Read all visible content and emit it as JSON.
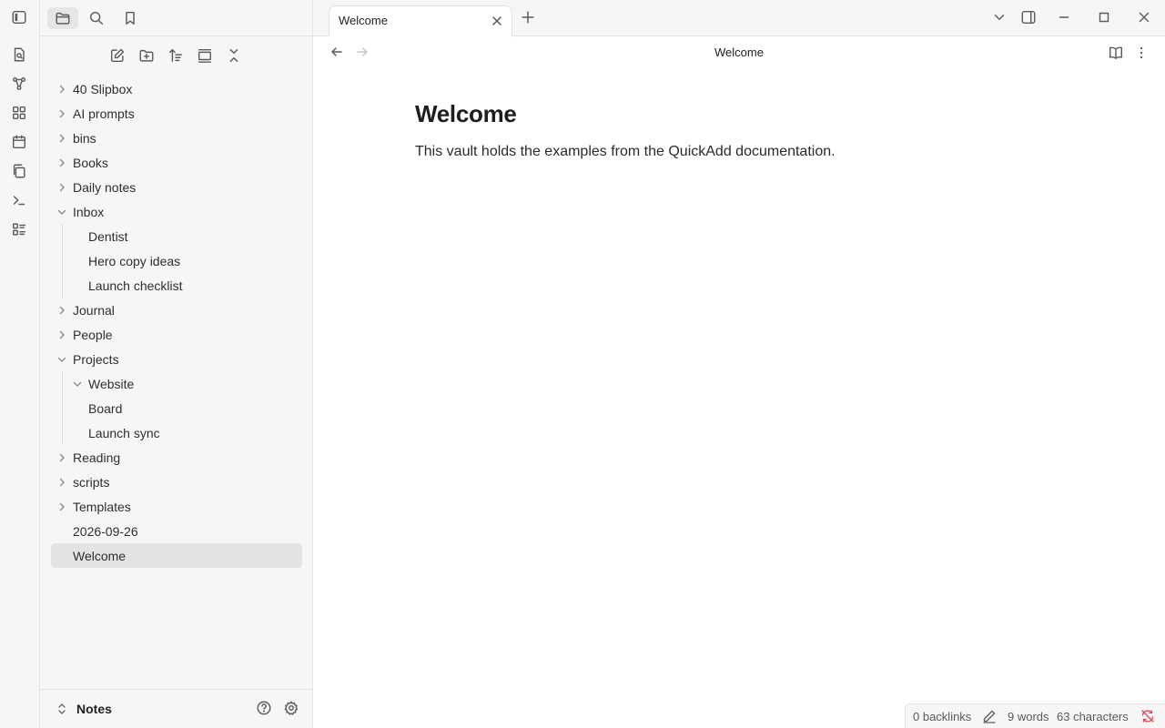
{
  "ribbon": {
    "toggle_icon": "sidebar-left-icon",
    "items": [
      {
        "name": "quick-switcher-icon"
      },
      {
        "name": "graph-view-icon"
      },
      {
        "name": "canvas-icon"
      },
      {
        "name": "daily-note-icon"
      },
      {
        "name": "templates-icon"
      },
      {
        "name": "command-palette-icon"
      },
      {
        "name": "kanban-icon"
      }
    ]
  },
  "sidebar": {
    "tabs": [
      "files",
      "search",
      "bookmarks"
    ],
    "active_tab": "files",
    "nav_actions": [
      "new-note",
      "new-folder",
      "sort-order",
      "auto-reveal",
      "collapse-all"
    ],
    "tree": [
      {
        "label": "40 Slipbox",
        "type": "folder",
        "expanded": false,
        "depth": 0
      },
      {
        "label": "AI prompts",
        "type": "folder",
        "expanded": false,
        "depth": 0
      },
      {
        "label": "bins",
        "type": "folder",
        "expanded": false,
        "depth": 0
      },
      {
        "label": "Books",
        "type": "folder",
        "expanded": false,
        "depth": 0
      },
      {
        "label": "Daily notes",
        "type": "folder",
        "expanded": false,
        "depth": 0
      },
      {
        "label": "Inbox",
        "type": "folder",
        "expanded": true,
        "depth": 0
      },
      {
        "label": "Dentist",
        "type": "file",
        "depth": 1
      },
      {
        "label": "Hero copy ideas",
        "type": "file",
        "depth": 1
      },
      {
        "label": "Launch checklist",
        "type": "file",
        "depth": 1
      },
      {
        "label": "Journal",
        "type": "folder",
        "expanded": false,
        "depth": 0
      },
      {
        "label": "People",
        "type": "folder",
        "expanded": false,
        "depth": 0
      },
      {
        "label": "Projects",
        "type": "folder",
        "expanded": true,
        "depth": 0
      },
      {
        "label": "Website",
        "type": "folder",
        "expanded": true,
        "depth": 1
      },
      {
        "label": "Board",
        "type": "file",
        "depth": 1
      },
      {
        "label": "Launch sync",
        "type": "file",
        "depth": 1
      },
      {
        "label": "Reading",
        "type": "folder",
        "expanded": false,
        "depth": 0
      },
      {
        "label": "scripts",
        "type": "folder",
        "expanded": false,
        "depth": 0
      },
      {
        "label": "Templates",
        "type": "folder",
        "expanded": false,
        "depth": 0
      },
      {
        "label": "2026-09-26",
        "type": "file",
        "depth": 0
      },
      {
        "label": "Welcome",
        "type": "file",
        "depth": 0,
        "active": true
      }
    ],
    "vault_name": "Notes"
  },
  "tabs": [
    {
      "label": "Welcome",
      "active": true
    }
  ],
  "view": {
    "title": "Welcome"
  },
  "note": {
    "heading": "Welcome",
    "body": "This vault holds the examples from the QuickAdd documentation."
  },
  "status": {
    "backlinks": "0 backlinks",
    "words": "9 words",
    "characters": "63 characters"
  },
  "colors": {
    "sidebar_bg": "#f6f6f6",
    "border": "#e3e3e3",
    "active_item": "#e4e4e4",
    "sync_error": "#e0445a"
  }
}
